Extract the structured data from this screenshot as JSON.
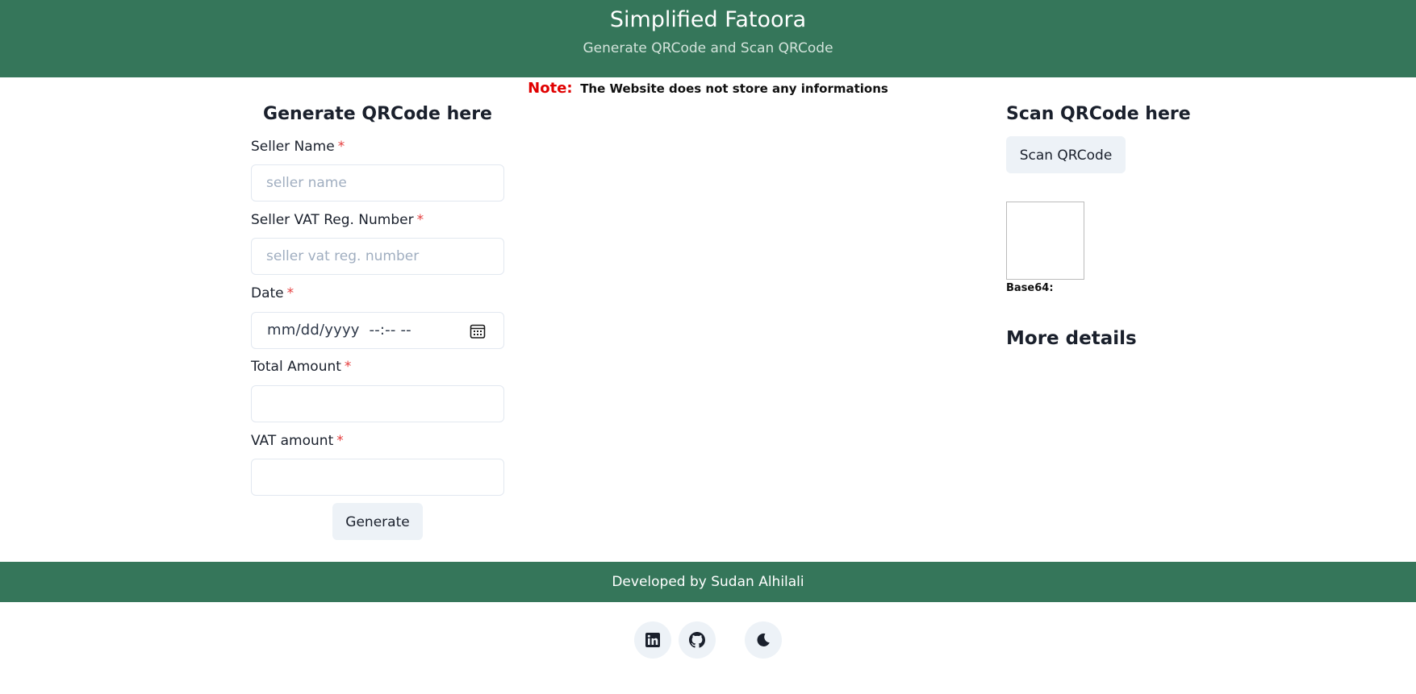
{
  "header": {
    "title": "Simplified Fatoora",
    "subtitle": "Generate QRCode and Scan QRCode"
  },
  "note": {
    "label": "Note:",
    "text": "The Website does not store any informations"
  },
  "generate": {
    "heading": "Generate QRCode here",
    "required_mark": "*",
    "seller_name": {
      "label": "Seller Name",
      "placeholder": "seller name",
      "value": ""
    },
    "seller_vat": {
      "label": "Seller VAT Reg. Number",
      "placeholder": "seller vat reg. number",
      "value": ""
    },
    "date": {
      "label": "Date",
      "display": "mm/dd/yyyy  --:-- --",
      "icon": "calendar-icon"
    },
    "total_amount": {
      "label": "Total Amount",
      "placeholder": "",
      "value": ""
    },
    "vat_amount": {
      "label": "VAT amount",
      "placeholder": "",
      "value": ""
    },
    "generate_button": "Generate"
  },
  "scan": {
    "heading": "Scan QRCode here",
    "scan_button": "Scan QRCode",
    "base64_label": "Base64:",
    "more_details": "More details"
  },
  "footer": {
    "credit": "Developed by Sudan Alhilali",
    "icons": [
      "linkedin-icon",
      "github-icon",
      "moon-icon"
    ]
  },
  "colors": {
    "header_bg": "#35765a",
    "required": "#e53e3e",
    "note_label": "#e00000",
    "button_bg": "#edf2f7"
  }
}
